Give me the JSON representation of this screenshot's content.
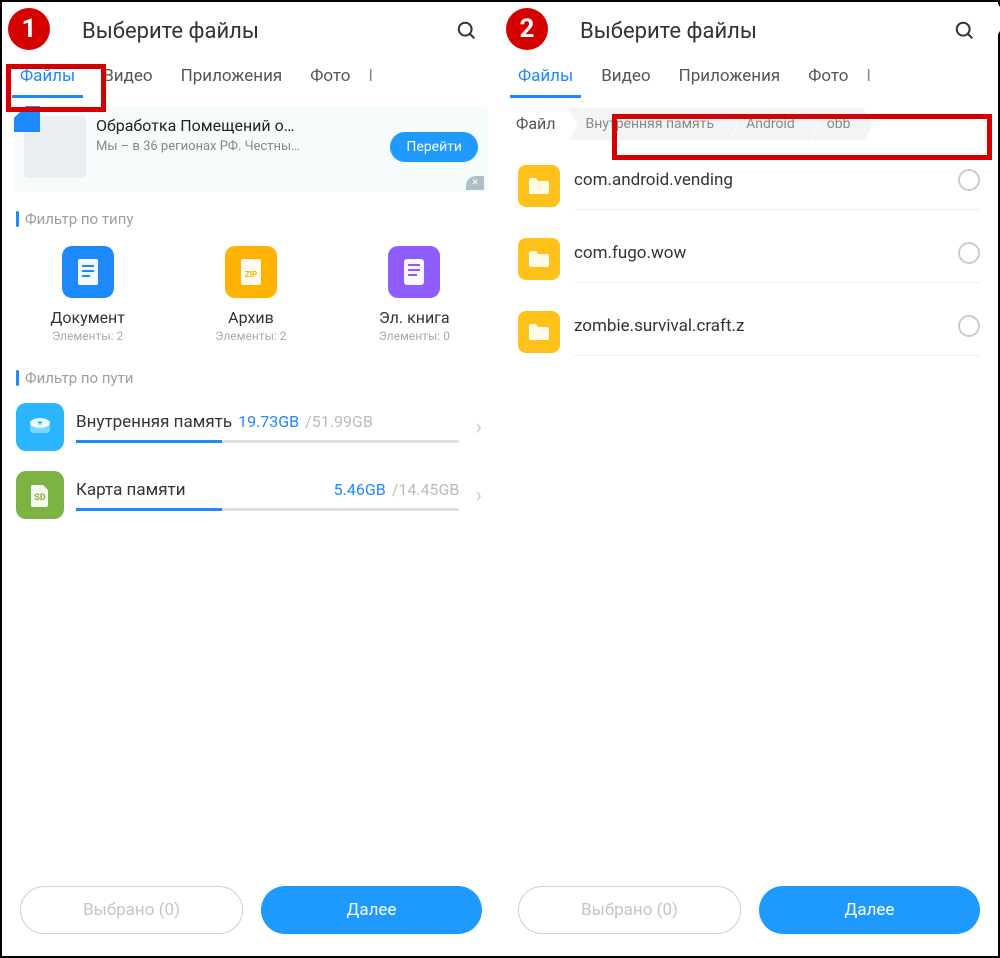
{
  "header": {
    "title": "Выберите файлы"
  },
  "tabs": {
    "files": "Файлы",
    "video": "Видео",
    "apps": "Приложения",
    "photo": "Фото"
  },
  "ad": {
    "title": "Обработка Помещений о…",
    "subtitle": "Мы – в 36 регионах РФ. Честны…",
    "cta": "Перейти"
  },
  "filter_type": {
    "heading": "Фильтр по типу",
    "items": [
      {
        "label": "Документ",
        "count": "Элементы: 2"
      },
      {
        "label": "Архив",
        "count": "Элементы: 2"
      },
      {
        "label": "Эл. книга",
        "count": "Элементы: 0"
      }
    ]
  },
  "filter_path": {
    "heading": "Фильтр по пути",
    "items": [
      {
        "name": "Внутренняя память",
        "used": "19.73GB",
        "total": "/51.99GB",
        "ratio": 0.38
      },
      {
        "name": "Карта памяти",
        "used": "5.46GB",
        "total": "/14.45GB",
        "ratio": 0.38
      }
    ]
  },
  "crumbs": [
    "Файл",
    "Внутренняя память",
    "Android",
    "obb"
  ],
  "folders": [
    {
      "name": "com.android.vending"
    },
    {
      "name": "com.fugo.wow"
    },
    {
      "name": "zombie.survival.craft.z"
    }
  ],
  "footer": {
    "selected": "Выбрано (0)",
    "next": "Далее"
  }
}
